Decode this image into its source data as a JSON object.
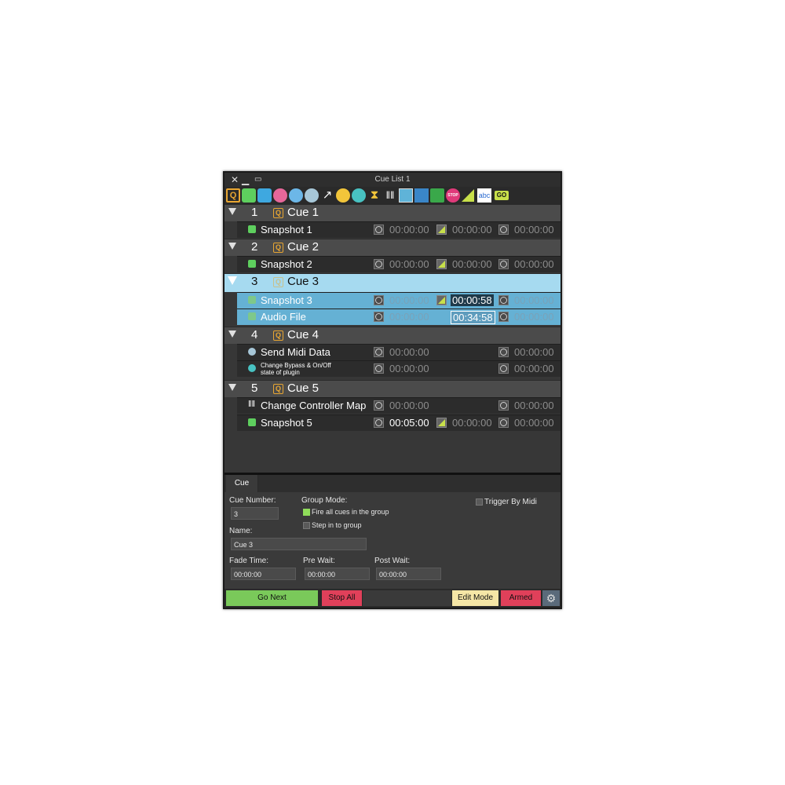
{
  "window": {
    "title": "Cue List 1"
  },
  "toolbar": {
    "icons": [
      "cue-icon",
      "snapshot-icon",
      "camera-icon",
      "midi-icon",
      "plugin-icon",
      "tempo-icon",
      "link-icon",
      "sync-icon",
      "bypass-icon",
      "metronome-icon",
      "controller-icon",
      "windows-icon",
      "tracks-icon",
      "audio-icon",
      "stop-icon",
      "fade-icon",
      "text-icon",
      "go-icon"
    ]
  },
  "groups": [
    {
      "number": "1",
      "name": "Cue 1"
    },
    {
      "number": "2",
      "name": "Cue 2"
    },
    {
      "number": "3",
      "name": "Cue 3"
    },
    {
      "number": "4",
      "name": "Cue 4"
    },
    {
      "number": "5",
      "name": "Cue 5"
    }
  ],
  "rows": [
    {
      "name": "Snapshot 1",
      "t1": "00:00:00",
      "t2": "00:00:00",
      "t3": "00:00:00"
    },
    {
      "name": "Snapshot 2",
      "t1": "00:00:00",
      "t2": "00:00:00",
      "t3": "00:00:00"
    },
    {
      "name": "Snapshot 3",
      "t1": "00:00:00",
      "t2": "00:00:58",
      "t3": "00:00:00"
    },
    {
      "name": "Audio File",
      "t1": "00:00:00",
      "t2": "00:34:58",
      "t3": "00:00:00"
    },
    {
      "name": "Send Midi Data",
      "t1": "00:00:00",
      "t3": "00:00:00"
    },
    {
      "name": "Change Bypass & On/Off",
      "name2": "state of plugin",
      "t1": "00:00:00",
      "t3": "00:00:00"
    },
    {
      "name": "Change Controller Map",
      "t1": "00:00:00",
      "t3": "00:00:00"
    },
    {
      "name": "Snapshot 5",
      "t1": "00:05:00",
      "t2": "00:00:00",
      "t3": "00:00:00"
    }
  ],
  "panel": {
    "tab": "Cue",
    "cue_number_label": "Cue Number:",
    "cue_number": "3",
    "name_label": "Name:",
    "name": "Cue 3",
    "group_mode_label": "Group Mode:",
    "fire_all": "Fire all cues in the group",
    "step_in": "Step in to group",
    "trigger_by_midi": "Trigger By Midi",
    "fade_time_label": "Fade Time:",
    "fade_time": "00:00:00",
    "pre_wait_label": "Pre Wait:",
    "pre_wait": "00:00:00",
    "post_wait_label": "Post Wait:",
    "post_wait": "00:00:00"
  },
  "footer": {
    "go_next": "Go Next",
    "stop_all": "Stop All",
    "edit_mode": "Edit Mode",
    "armed": "Armed"
  },
  "colors": {
    "accent_go": "#7ac95a",
    "stop": "#e0405a",
    "edit": "#f5e6a6",
    "armed": "#e0405a",
    "selection": "#a6daf0"
  }
}
